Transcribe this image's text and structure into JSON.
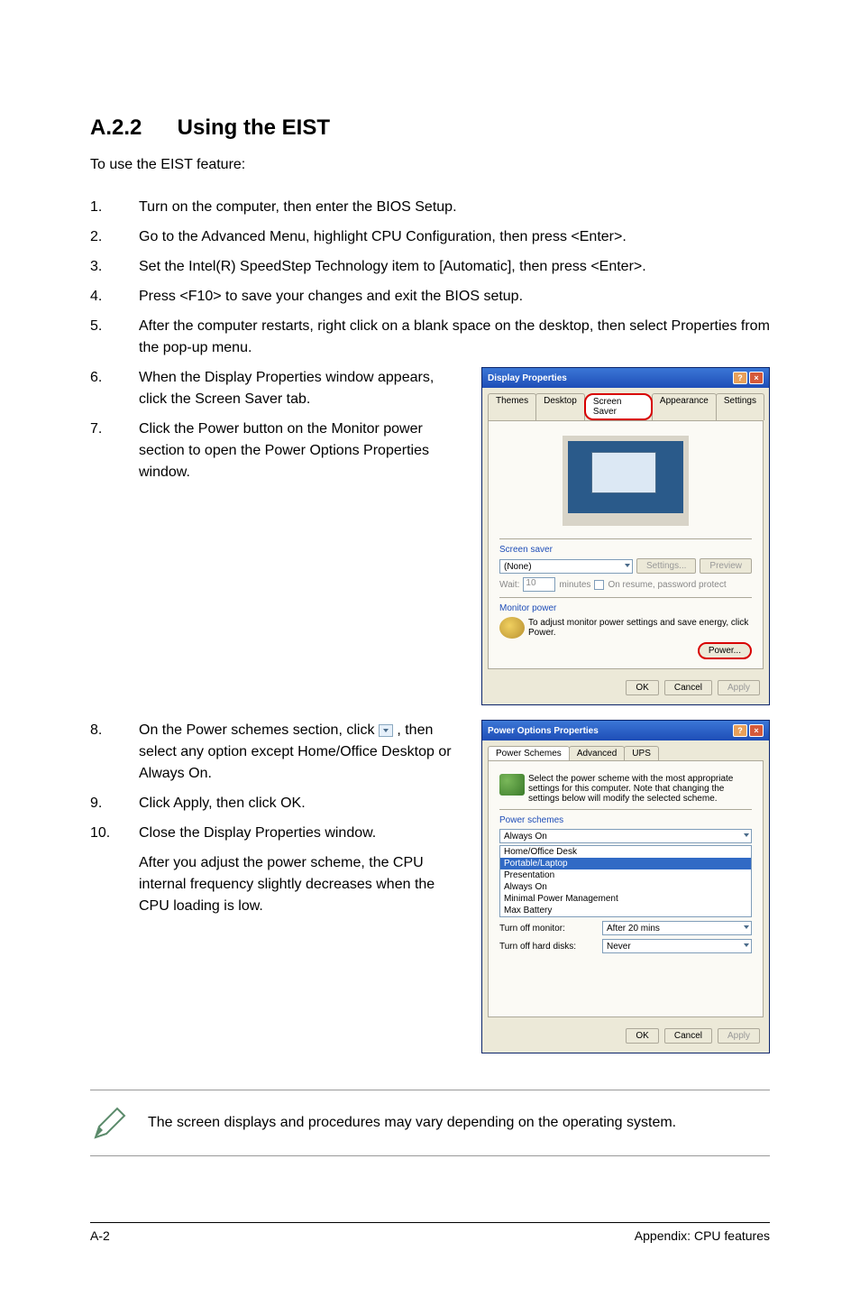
{
  "heading_num": "A.2.2",
  "heading_text": "Using the EIST",
  "intro": "To use the EIST feature:",
  "steps": [
    "Turn on the computer, then enter the BIOS Setup.",
    "Go to the Advanced Menu, highlight CPU Configuration, then press <Enter>.",
    "Set the Intel(R) SpeedStep Technology item to [Automatic], then press <Enter>.",
    "Press <F10> to save your changes and exit the BIOS setup.",
    "After the computer restarts, right click on a blank space on the desktop, then select Properties from the pop-up menu.",
    "When the Display Properties window appears, click the Screen Saver tab.",
    "Click the Power button on the Monitor power section to open the Power Options Properties window.",
    "On the Power schemes section, click ",
    ", then select any option except Home/Office Desktop or Always On.",
    "Click Apply, then click OK.",
    "Close the Display Properties window."
  ],
  "after_note": "After you adjust the power scheme, the CPU internal frequency slightly decreases when the CPU loading is low.",
  "callout_text": "The screen displays and procedures may vary depending on the operating system.",
  "display_dialog": {
    "title": "Display Properties",
    "tabs": [
      "Themes",
      "Desktop",
      "Screen Saver",
      "Appearance",
      "Settings"
    ],
    "screensaver_label": "Screen saver",
    "screensaver_value": "(None)",
    "settings_btn": "Settings...",
    "preview_btn": "Preview",
    "wait_label": "Wait:",
    "wait_value": "10",
    "wait_unit": "minutes",
    "resume_check": "On resume, password protect",
    "monitor_label": "Monitor power",
    "monitor_text": "To adjust monitor power settings and save energy, click Power.",
    "power_btn": "Power...",
    "ok": "OK",
    "cancel": "Cancel",
    "apply": "Apply"
  },
  "power_dialog": {
    "title": "Power Options Properties",
    "tabs": [
      "Power Schemes",
      "Advanced",
      "UPS"
    ],
    "desc": "Select the power scheme with the most appropriate settings for this computer. Note that changing the settings below will modify the selected scheme.",
    "schemes_label": "Power schemes",
    "scheme_selected": "Always On",
    "scheme_options": [
      "Home/Office Desk",
      "Portable/Laptop",
      "Presentation",
      "Always On",
      "Minimal Power Management",
      "Max Battery"
    ],
    "turn_off_monitor_label": "Turn off monitor:",
    "turn_off_monitor_value": "After 20 mins",
    "turn_off_disks_label": "Turn off hard disks:",
    "turn_off_disks_value": "Never",
    "ok": "OK",
    "cancel": "Cancel",
    "apply": "Apply"
  },
  "footer_left": "A-2",
  "footer_right": "Appendix: CPU features"
}
